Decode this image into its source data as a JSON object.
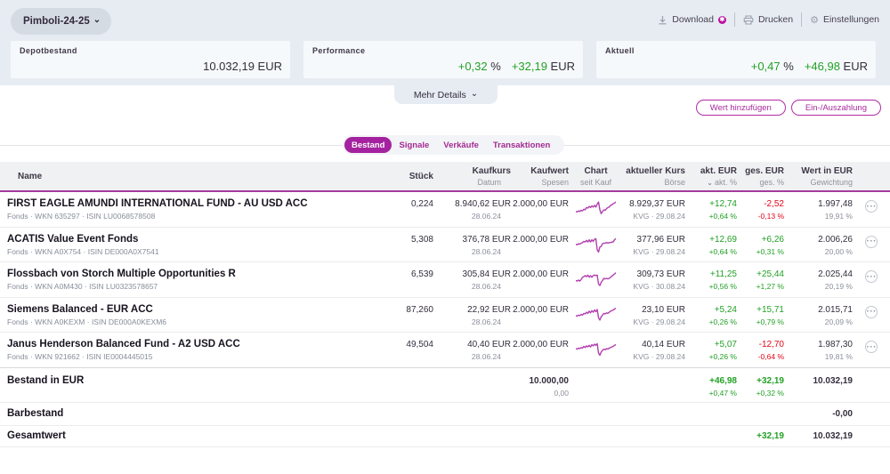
{
  "header": {
    "portfolio_selector": {
      "label": "Pimboli-24-25"
    },
    "actions": {
      "download": "Download",
      "print": "Drucken",
      "settings": "Einstellungen"
    },
    "cards": [
      {
        "label": "Depotbestand",
        "value": "10.032,19 EUR"
      },
      {
        "label": "Performance",
        "percent": "+0,32",
        "percent_unit": " %",
        "amount": "+32,19",
        "amount_unit": " EUR"
      },
      {
        "label": "Aktuell",
        "percent": "+0,47",
        "percent_unit": " %",
        "amount": "+46,98",
        "amount_unit": " EUR"
      }
    ],
    "more_details": "Mehr Details"
  },
  "toolbar": {
    "add_value": "Wert hinzufügen",
    "payment": "Ein-/Auszahlung"
  },
  "tabs": [
    {
      "label": "Bestand",
      "active": true
    },
    {
      "label": "Signale",
      "active": false
    },
    {
      "label": "Verkäufe",
      "active": false
    },
    {
      "label": "Transaktionen",
      "active": false
    }
  ],
  "table": {
    "columns": [
      {
        "title": "Name",
        "sub": ""
      },
      {
        "title": "Stück",
        "sub": ""
      },
      {
        "title": "Kaufkurs",
        "sub": "Datum",
        "sub_offset": true
      },
      {
        "title": "Kaufwert",
        "sub": "Spesen"
      },
      {
        "title": "Chart",
        "sub": "seit Kauf"
      },
      {
        "title": "aktueller Kurs",
        "sub": "Börse"
      },
      {
        "title": "akt. EUR",
        "sub": "akt. %",
        "sorted": true
      },
      {
        "title": "ges. EUR",
        "sub": "ges. %"
      },
      {
        "title": "Wert in EUR",
        "sub": "Gewichtung"
      }
    ],
    "rows": [
      {
        "name": "FIRST EAGLE AMUNDI INTERNATIONAL FUND - AU USD ACC",
        "details": "Fonds · WKN 635297 · ISIN LU0068578508",
        "shares": "0,224",
        "buy_price": "8.940,62 EUR",
        "buy_date": "28.06.24",
        "buy_value": "2.000,00 EUR",
        "spark": [
          11,
          11.5,
          10.5,
          11,
          10,
          10.5,
          9,
          9.5,
          7.5,
          8,
          6.5,
          7.5,
          6,
          7,
          5.5,
          7,
          4.5,
          2.5,
          9.5,
          13,
          11,
          9.5,
          10,
          8.5,
          7.5,
          7,
          5.5,
          5,
          4,
          3.5,
          2.5
        ],
        "current_price": "8.929,37 EUR",
        "exchange": "KVG · 29.08.24",
        "day_eur": "+12,74",
        "day_pct": "+0,64 %",
        "day_dir": "up",
        "total_eur": "-2,52",
        "total_pct": "-0,13 %",
        "total_dir": "down",
        "value_eur": "1.997,48",
        "weight": "19,91 %"
      },
      {
        "name": "ACATIS Value Event Fonds",
        "details": "Fonds · WKN A0X754 · ISIN DE000A0X7541",
        "shares": "5,308",
        "buy_price": "376,78 EUR",
        "buy_date": "28.06.24",
        "buy_value": "2.000,00 EUR",
        "spark": [
          8.5,
          9,
          8,
          8.5,
          7.5,
          7,
          6,
          6.5,
          5,
          6.5,
          4.5,
          6.5,
          4.5,
          6,
          4,
          3.5,
          13.5,
          15.5,
          11,
          10.5,
          8,
          7.5,
          7.5,
          7,
          7.5,
          7,
          7,
          6.5,
          6.5,
          4.5,
          3.5
        ],
        "current_price": "377,96 EUR",
        "exchange": "KVG · 29.08.24",
        "day_eur": "+12,69",
        "day_pct": "+0,64 %",
        "day_dir": "up",
        "total_eur": "+6,26",
        "total_pct": "+0,31 %",
        "total_dir": "up",
        "value_eur": "2.006,26",
        "weight": "20,00 %"
      },
      {
        "name": "Flossbach von Storch Multiple Opportunities R",
        "details": "Fonds · WKN A0M430 · ISIN LU0323578657",
        "shares": "6,539",
        "buy_price": "305,84 EUR",
        "buy_date": "28.06.24",
        "buy_value": "2.000,00 EUR",
        "spark": [
          10,
          10.5,
          9.5,
          10.5,
          9,
          7,
          6.5,
          5.5,
          6.5,
          5,
          7,
          5.5,
          7,
          5.5,
          5,
          5.5,
          5,
          13,
          14.5,
          11.5,
          10,
          8,
          8.5,
          8,
          8.5,
          8,
          7,
          6,
          5,
          4,
          3
        ],
        "current_price": "309,73 EUR",
        "exchange": "KVG · 30.08.24",
        "day_eur": "+11,25",
        "day_pct": "+0,56 %",
        "day_dir": "up",
        "total_eur": "+25,44",
        "total_pct": "+1,27 %",
        "total_dir": "up",
        "value_eur": "2.025,44",
        "weight": "20,19 %"
      },
      {
        "name": "Siemens Balanced - EUR ACC",
        "details": "Fonds · WKN A0KEXM · ISIN DE000A0KEXM6",
        "shares": "87,260",
        "buy_price": "22,92 EUR",
        "buy_date": "28.06.24",
        "buy_value": "2.000,00 EUR",
        "spark": [
          9.5,
          10,
          9,
          9.5,
          8.5,
          9,
          7.5,
          8,
          6.5,
          7.5,
          5.5,
          7,
          5,
          6.5,
          4.5,
          6,
          4,
          11.5,
          13.5,
          10.5,
          9,
          7.5,
          8,
          7,
          7.5,
          6.5,
          5.5,
          5,
          4.5,
          3.5,
          3
        ],
        "current_price": "23,10 EUR",
        "exchange": "KVG · 29.08.24",
        "day_eur": "+5,24",
        "day_pct": "+0,26 %",
        "day_dir": "up",
        "total_eur": "+15,71",
        "total_pct": "+0,79 %",
        "total_dir": "up",
        "value_eur": "2.015,71",
        "weight": "20,09 %"
      },
      {
        "name": "Janus Henderson Balanced Fund - A2 USD ACC",
        "details": "Fonds · WKN 921662 · ISIN IE0004445015",
        "shares": "49,504",
        "buy_price": "40,40 EUR",
        "buy_date": "28.06.24",
        "buy_value": "2.000,00 EUR",
        "spark": [
          8,
          8.5,
          7.5,
          8,
          7,
          7.5,
          6,
          7,
          5.5,
          6.5,
          5,
          6.5,
          4.5,
          5.5,
          4,
          5,
          3.5,
          12,
          14,
          11,
          9.5,
          8.5,
          9,
          8,
          8.5,
          7.5,
          7,
          6.5,
          6,
          5,
          4.5
        ],
        "current_price": "40,14 EUR",
        "exchange": "KVG · 29.08.24",
        "day_eur": "+5,07",
        "day_pct": "+0,26 %",
        "day_dir": "up",
        "total_eur": "-12,70",
        "total_pct": "-0,64 %",
        "total_dir": "down",
        "value_eur": "1.987,30",
        "weight": "19,81 %"
      }
    ],
    "summary": [
      {
        "label": "Bestand in EUR",
        "buy_value": "10.000,00",
        "fees": "0,00",
        "day_eur": "+46,98",
        "day_pct": "+0,47 %",
        "day_dir": "up",
        "total_eur": "+32,19",
        "total_pct": "+0,32 %",
        "total_dir": "up",
        "value_eur": "10.032,19"
      },
      {
        "label": "Barbestand",
        "value_eur": "-0,00"
      },
      {
        "label": "Gesamtwert",
        "total_eur": "+32,19",
        "total_dir": "up",
        "value_eur": "10.032,19"
      }
    ]
  },
  "icons": {
    "chevron_down": "⌄",
    "gear": "⚙",
    "new_badge": "✱",
    "sort_chevron": "⌄",
    "ellipsis": "···"
  },
  "colors": {
    "brand_magenta": "#a4229f",
    "positive_green": "#22a126",
    "negative_red": "#e30617",
    "band_background": "#e7ecf2",
    "sparkline": "#b13fae"
  }
}
